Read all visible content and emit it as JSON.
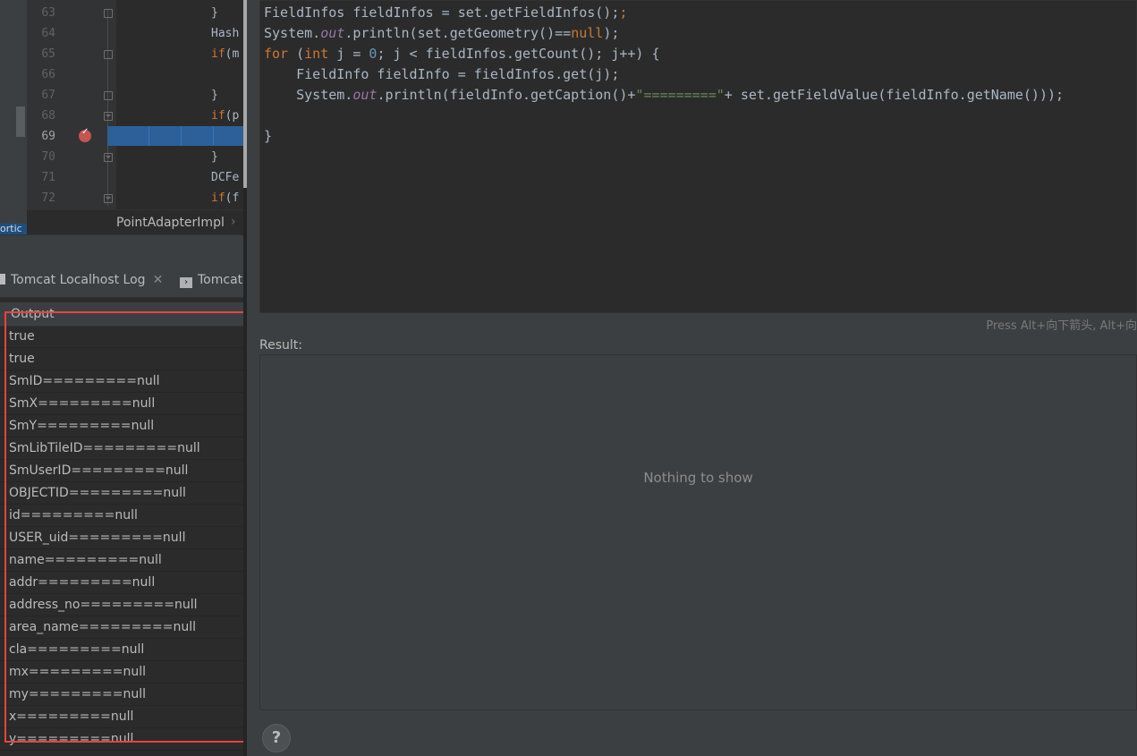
{
  "editor": {
    "lines": [
      {
        "num": "63",
        "code": "}",
        "fold": true
      },
      {
        "num": "64",
        "code": "Hash",
        "fold": false
      },
      {
        "num": "65",
        "code": "if(m",
        "kw": true,
        "fold": true
      },
      {
        "num": "66",
        "code": "",
        "fold": false
      },
      {
        "num": "67",
        "code": "}",
        "fold": true
      },
      {
        "num": "68",
        "code": "if(p",
        "kw": true,
        "fold": true
      },
      {
        "num": "69",
        "code": "",
        "fold": false
      },
      {
        "num": "70",
        "code": "}",
        "fold": true
      },
      {
        "num": "71",
        "code": "DCFe",
        "fold": false
      },
      {
        "num": "72",
        "code": "if(f",
        "kw": true,
        "fold": true
      }
    ],
    "breadcrumb": "PointAdapterImpl",
    "breadcrumb_chevron": "›",
    "left_strip_text": "ortic"
  },
  "tabs": {
    "log_tab": "Tomcat Localhost Log",
    "log_tab_close": "✕",
    "tomcat_tab": "Tomcat"
  },
  "output": {
    "header": "Output",
    "rows": [
      "true",
      "true",
      "SmID=========null",
      "SmX=========null",
      "SmY=========null",
      "SmLibTileID=========null",
      "SmUserID=========null",
      "OBJECTID=========null",
      "id=========null",
      "USER_uid=========null",
      "name=========null",
      "addr=========null",
      "address_no=========null",
      "area_name=========null",
      "cla=========null",
      "mx=========null",
      "my=========null",
      "x=========null",
      "y=========null"
    ]
  },
  "evaluate": {
    "code": {
      "l1": "FieldInfos fieldInfos = set.getFieldInfos();",
      "l2_a": "System.",
      "l2_b": "out",
      "l2_c": ".println(set.getGeometry()==",
      "l2_d": "null",
      "l2_e": ");",
      "l3_a": "for",
      "l3_b": " (",
      "l3_c": "int",
      "l3_d": " j = ",
      "l3_e": "0",
      "l3_f": "; j < fieldInfos.getCount(); j++) {",
      "l4": "    FieldInfo fieldInfo = fieldInfos.get(j);",
      "l5_a": "    System.",
      "l5_b": "out",
      "l5_c": ".println(fieldInfo.getCaption()+",
      "l5_d": "\"=========\"",
      "l5_e": "+ set.getFieldValue(fieldInfo.getName()));",
      "l7": "}"
    },
    "hint": "Press Alt+向下箭头, Alt+向",
    "result_label": "Result:",
    "empty_text": "Nothing to show",
    "help_label": "?"
  },
  "colors": {
    "keyword": "#cc7832",
    "field": "#9876aa",
    "number": "#6897bb",
    "string": "#6a8759",
    "exec_line": "#2d6099",
    "highlight_box": "#e84343"
  }
}
